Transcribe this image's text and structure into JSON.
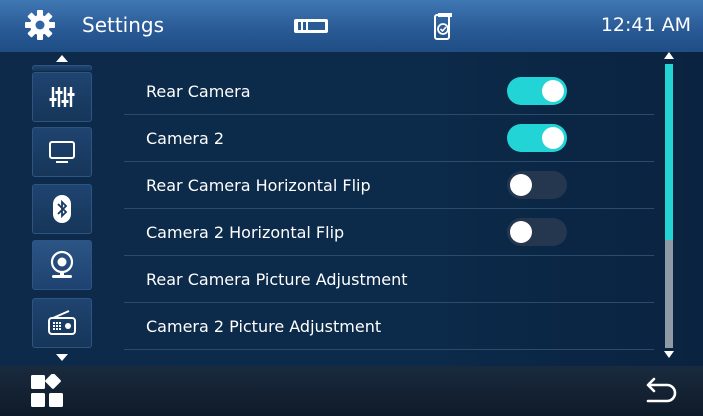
{
  "header": {
    "title": "Settings",
    "icons": [
      "gear-icon",
      "battery-icon",
      "phone-link-icon"
    ],
    "time": "12:41 AM"
  },
  "sidebar": {
    "items": [
      {
        "icon": "equalizer-icon",
        "active": false
      },
      {
        "icon": "display-icon",
        "active": false
      },
      {
        "icon": "bluetooth-icon",
        "active": false
      },
      {
        "icon": "camera-icon",
        "active": true
      },
      {
        "icon": "radio-icon",
        "active": false
      }
    ]
  },
  "settings": {
    "rows": [
      {
        "label": "Rear Camera",
        "toggle": "on"
      },
      {
        "label": "Camera 2",
        "toggle": "on"
      },
      {
        "label": "Rear Camera Horizontal Flip",
        "toggle": "off"
      },
      {
        "label": "Camera 2 Horizontal Flip",
        "toggle": "off"
      },
      {
        "label": "Rear Camera Picture Adjustment"
      },
      {
        "label": "Camera 2 Picture Adjustment"
      }
    ]
  },
  "footer": {
    "icons": [
      "apps-grid-icon",
      "back-icon"
    ]
  },
  "colors": {
    "accent": "#22d4d6",
    "header": "#2a5b96",
    "background": "#0c2a4a"
  }
}
